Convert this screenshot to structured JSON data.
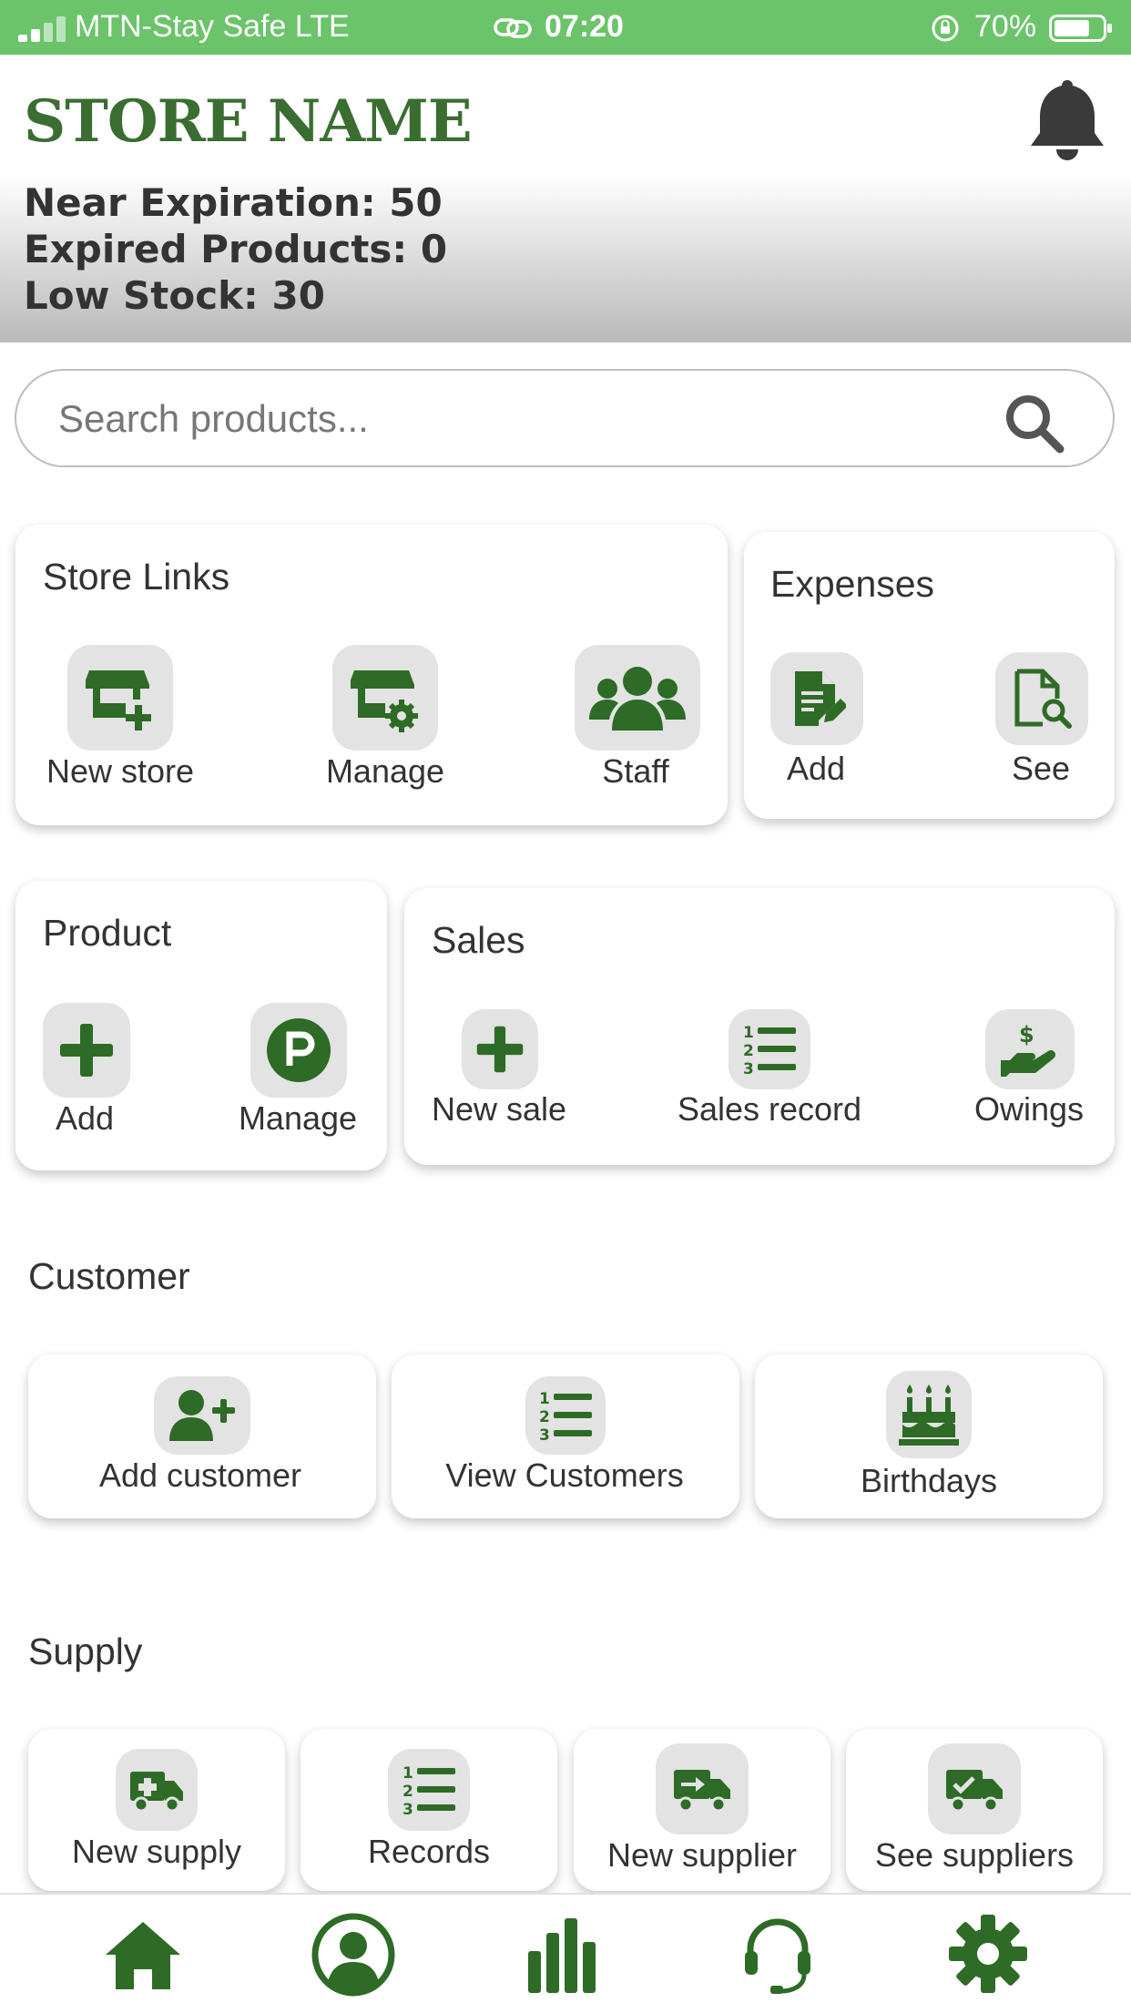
{
  "status_bar": {
    "carrier": "MTN-Stay Safe  LTE",
    "time": "07:20",
    "battery": "70%"
  },
  "header": {
    "store_name": "STORE NAME",
    "near_expiration": "Near Expiration: 50",
    "expired_products": "Expired Products: 0",
    "low_stock": "Low Stock: 30"
  },
  "search": {
    "placeholder": "Search products..."
  },
  "store_links": {
    "title": "Store Links",
    "new_store": "New store",
    "manage": "Manage",
    "staff": "Staff"
  },
  "expenses": {
    "title": "Expenses",
    "add": "Add",
    "see": "See"
  },
  "product": {
    "title": "Product",
    "add": "Add",
    "manage": "Manage"
  },
  "sales": {
    "title": "Sales",
    "new_sale": "New sale",
    "sales_record": "Sales record",
    "owings": "Owings"
  },
  "customer": {
    "title": "Customer",
    "add_customer": "Add customer",
    "view_customers": "View Customers",
    "birthdays": "Birthdays"
  },
  "supply": {
    "title": "Supply",
    "new_supply": "New supply",
    "records": "Records",
    "new_supplier": "New supplier",
    "see_suppliers": "See suppliers"
  },
  "bottom_nav": [
    "home-icon",
    "profile-icon",
    "analytics-icon",
    "support-icon",
    "settings-icon"
  ],
  "colors": {
    "status_bar": "#6bc46a",
    "brand_green": "#3a6e31",
    "icon_green": "#2e6b26",
    "tile_gray": "#e3e3e3"
  }
}
